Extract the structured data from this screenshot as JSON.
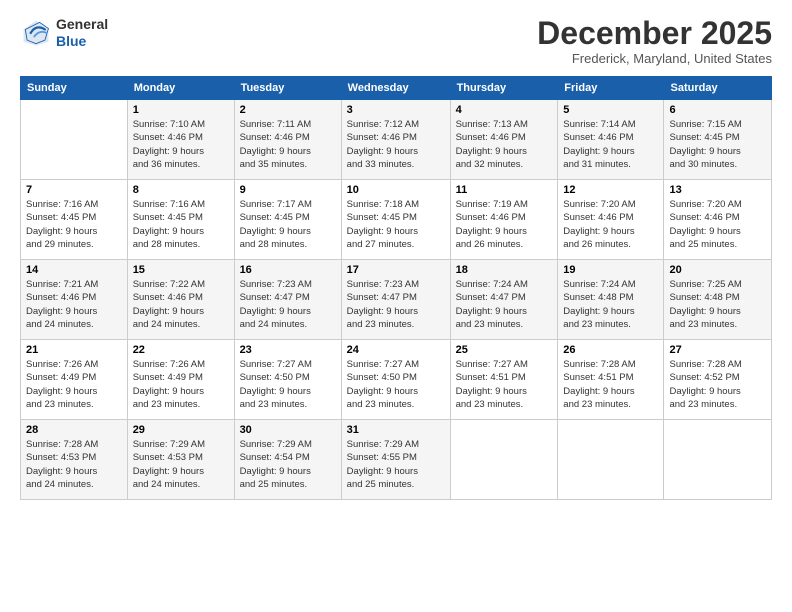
{
  "header": {
    "logo_line1": "General",
    "logo_line2": "Blue",
    "month": "December 2025",
    "location": "Frederick, Maryland, United States"
  },
  "weekdays": [
    "Sunday",
    "Monday",
    "Tuesday",
    "Wednesday",
    "Thursday",
    "Friday",
    "Saturday"
  ],
  "weeks": [
    [
      {
        "day": "",
        "info": ""
      },
      {
        "day": "1",
        "info": "Sunrise: 7:10 AM\nSunset: 4:46 PM\nDaylight: 9 hours\nand 36 minutes."
      },
      {
        "day": "2",
        "info": "Sunrise: 7:11 AM\nSunset: 4:46 PM\nDaylight: 9 hours\nand 35 minutes."
      },
      {
        "day": "3",
        "info": "Sunrise: 7:12 AM\nSunset: 4:46 PM\nDaylight: 9 hours\nand 33 minutes."
      },
      {
        "day": "4",
        "info": "Sunrise: 7:13 AM\nSunset: 4:46 PM\nDaylight: 9 hours\nand 32 minutes."
      },
      {
        "day": "5",
        "info": "Sunrise: 7:14 AM\nSunset: 4:46 PM\nDaylight: 9 hours\nand 31 minutes."
      },
      {
        "day": "6",
        "info": "Sunrise: 7:15 AM\nSunset: 4:45 PM\nDaylight: 9 hours\nand 30 minutes."
      }
    ],
    [
      {
        "day": "7",
        "info": "Sunrise: 7:16 AM\nSunset: 4:45 PM\nDaylight: 9 hours\nand 29 minutes."
      },
      {
        "day": "8",
        "info": "Sunrise: 7:16 AM\nSunset: 4:45 PM\nDaylight: 9 hours\nand 28 minutes."
      },
      {
        "day": "9",
        "info": "Sunrise: 7:17 AM\nSunset: 4:45 PM\nDaylight: 9 hours\nand 28 minutes."
      },
      {
        "day": "10",
        "info": "Sunrise: 7:18 AM\nSunset: 4:45 PM\nDaylight: 9 hours\nand 27 minutes."
      },
      {
        "day": "11",
        "info": "Sunrise: 7:19 AM\nSunset: 4:46 PM\nDaylight: 9 hours\nand 26 minutes."
      },
      {
        "day": "12",
        "info": "Sunrise: 7:20 AM\nSunset: 4:46 PM\nDaylight: 9 hours\nand 26 minutes."
      },
      {
        "day": "13",
        "info": "Sunrise: 7:20 AM\nSunset: 4:46 PM\nDaylight: 9 hours\nand 25 minutes."
      }
    ],
    [
      {
        "day": "14",
        "info": "Sunrise: 7:21 AM\nSunset: 4:46 PM\nDaylight: 9 hours\nand 24 minutes."
      },
      {
        "day": "15",
        "info": "Sunrise: 7:22 AM\nSunset: 4:46 PM\nDaylight: 9 hours\nand 24 minutes."
      },
      {
        "day": "16",
        "info": "Sunrise: 7:23 AM\nSunset: 4:47 PM\nDaylight: 9 hours\nand 24 minutes."
      },
      {
        "day": "17",
        "info": "Sunrise: 7:23 AM\nSunset: 4:47 PM\nDaylight: 9 hours\nand 23 minutes."
      },
      {
        "day": "18",
        "info": "Sunrise: 7:24 AM\nSunset: 4:47 PM\nDaylight: 9 hours\nand 23 minutes."
      },
      {
        "day": "19",
        "info": "Sunrise: 7:24 AM\nSunset: 4:48 PM\nDaylight: 9 hours\nand 23 minutes."
      },
      {
        "day": "20",
        "info": "Sunrise: 7:25 AM\nSunset: 4:48 PM\nDaylight: 9 hours\nand 23 minutes."
      }
    ],
    [
      {
        "day": "21",
        "info": "Sunrise: 7:26 AM\nSunset: 4:49 PM\nDaylight: 9 hours\nand 23 minutes."
      },
      {
        "day": "22",
        "info": "Sunrise: 7:26 AM\nSunset: 4:49 PM\nDaylight: 9 hours\nand 23 minutes."
      },
      {
        "day": "23",
        "info": "Sunrise: 7:27 AM\nSunset: 4:50 PM\nDaylight: 9 hours\nand 23 minutes."
      },
      {
        "day": "24",
        "info": "Sunrise: 7:27 AM\nSunset: 4:50 PM\nDaylight: 9 hours\nand 23 minutes."
      },
      {
        "day": "25",
        "info": "Sunrise: 7:27 AM\nSunset: 4:51 PM\nDaylight: 9 hours\nand 23 minutes."
      },
      {
        "day": "26",
        "info": "Sunrise: 7:28 AM\nSunset: 4:51 PM\nDaylight: 9 hours\nand 23 minutes."
      },
      {
        "day": "27",
        "info": "Sunrise: 7:28 AM\nSunset: 4:52 PM\nDaylight: 9 hours\nand 23 minutes."
      }
    ],
    [
      {
        "day": "28",
        "info": "Sunrise: 7:28 AM\nSunset: 4:53 PM\nDaylight: 9 hours\nand 24 minutes."
      },
      {
        "day": "29",
        "info": "Sunrise: 7:29 AM\nSunset: 4:53 PM\nDaylight: 9 hours\nand 24 minutes."
      },
      {
        "day": "30",
        "info": "Sunrise: 7:29 AM\nSunset: 4:54 PM\nDaylight: 9 hours\nand 25 minutes."
      },
      {
        "day": "31",
        "info": "Sunrise: 7:29 AM\nSunset: 4:55 PM\nDaylight: 9 hours\nand 25 minutes."
      },
      {
        "day": "",
        "info": ""
      },
      {
        "day": "",
        "info": ""
      },
      {
        "day": "",
        "info": ""
      }
    ]
  ]
}
